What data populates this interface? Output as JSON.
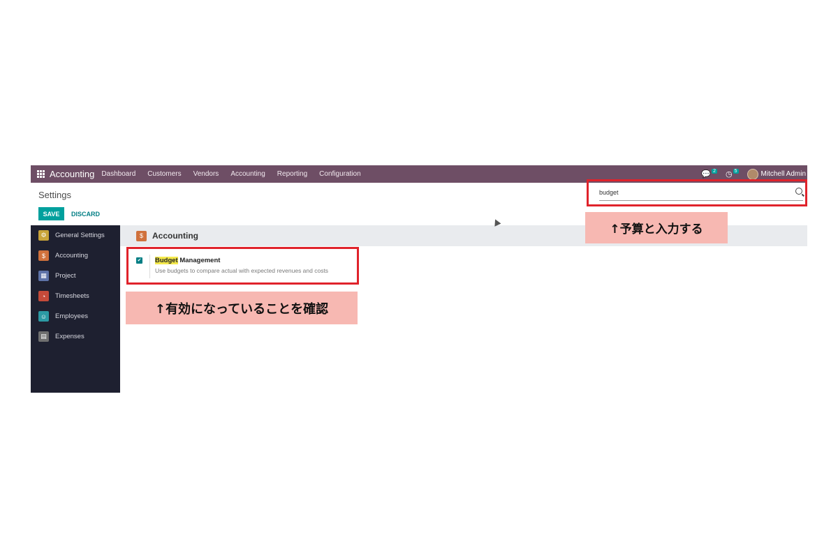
{
  "navbar": {
    "app_title": "Accounting",
    "menu": [
      "Dashboard",
      "Customers",
      "Vendors",
      "Accounting",
      "Reporting",
      "Configuration"
    ],
    "messages_count": "2",
    "activities_count": "5",
    "user_name": "Mitchell Admin"
  },
  "control_panel": {
    "title": "Settings",
    "save_label": "SAVE",
    "discard_label": "DISCARD",
    "search_value": "budget"
  },
  "sidebar": {
    "items": [
      {
        "label": "General Settings",
        "icon": "gear-icon",
        "color": "#c9a43a"
      },
      {
        "label": "Accounting",
        "icon": "accounting-icon",
        "color": "#d0713c"
      },
      {
        "label": "Project",
        "icon": "project-icon",
        "color": "#5e73a8"
      },
      {
        "label": "Timesheets",
        "icon": "stopwatch-icon",
        "color": "#c44a3a"
      },
      {
        "label": "Employees",
        "icon": "employees-icon",
        "color": "#2c9aa4"
      },
      {
        "label": "Expenses",
        "icon": "expenses-icon",
        "color": "#6f6f6f"
      }
    ]
  },
  "section": {
    "title": "Accounting",
    "setting": {
      "title_highlight": "Budget",
      "title_rest": " Management",
      "description": "Use budgets to compare actual with expected revenues and costs",
      "checked": true
    }
  },
  "annotations": {
    "search_note": "↑予算と入力する",
    "setting_note": "↑有効になっていることを確認",
    "highlight_color": "#e0232b"
  }
}
